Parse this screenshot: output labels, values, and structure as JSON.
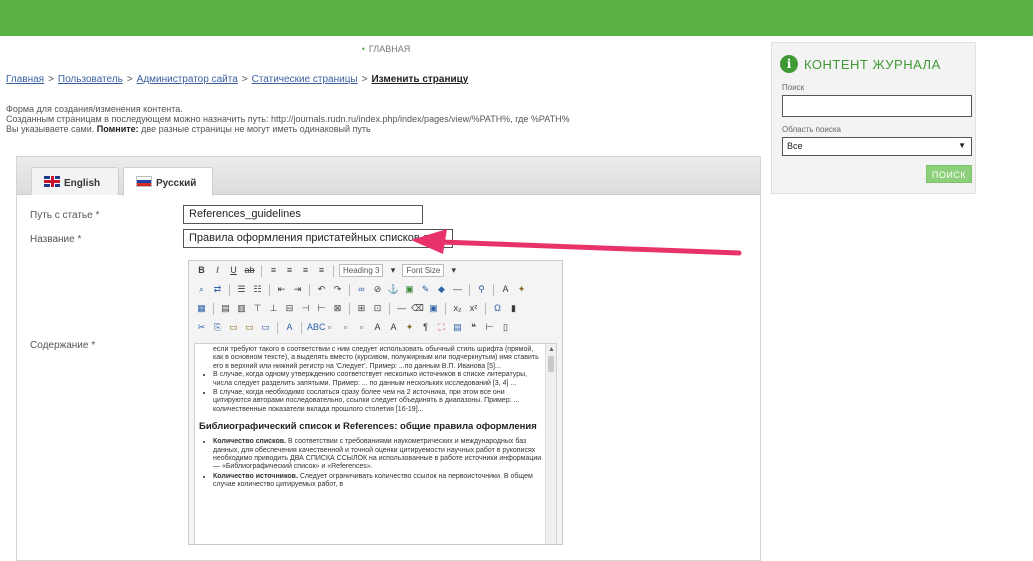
{
  "nav": {
    "home_label": "ГЛАВНАЯ"
  },
  "breadcrumb": {
    "items": [
      "Главная",
      "Пользователь",
      "Администратор сайта",
      "Статические страницы"
    ],
    "separator": ">",
    "current": "Изменить страницу"
  },
  "intro": {
    "line1": "Форма для создания/изменения контента.",
    "line2": "Созданным страницам в последующем можно назначить путь: http://journals.rudn.ru/index.php/index/pages/view/%PATH%, где %PATH%",
    "line3_prefix": "Вы указываете сами.",
    "line3_bold": "Помните:",
    "line3_suffix": "две разные страницы не могут иметь одинаковый путь"
  },
  "tabs": [
    {
      "label": "English",
      "flag": "uk-flag-icon"
    },
    {
      "label": "Русский",
      "flag": "ru-flag-icon"
    }
  ],
  "form": {
    "path_label": "Путь с статье *",
    "path_value": "References_guidelines",
    "title_label": "Название *",
    "title_value": "Правила оформления пристатейных списков л",
    "content_label": "Содержание *"
  },
  "editor": {
    "toolbar": {
      "bold": "B",
      "italic": "I",
      "underline": "U",
      "strike": "ab",
      "format_select": "Heading 3",
      "fontsize_select": "Font Size"
    },
    "content": {
      "para1": "если требуют такого в соответствии с ним следует использовать обычный стиль шрифта (прямой, как в основном тексте), а выделять вместо (курсивом, полужирным или подчеркнутым) имя ставить его в верхний или нижний регистр на 'Следует'. Пример: ...по данным В.П. Иванова [5]...",
      "bullet1": "В случае, когда одному утверждению соответствует несколько источников в списке литературы, числа следует разделить запятыми. Пример: ... по данным нескольких исследований [3, 4] ...",
      "bullet2": "В случае, когда необходимо сослаться сразу более чем на 2 источника, при этом все они цитируются авторами последовательно, ссылки следует объединять в диапазоны. Пример: ... количественные показатели вклада прошлого столетия [16-19]...",
      "heading": "Библиографический список и References: общие правила оформления",
      "bullet3_bold": "Количество списков.",
      "bullet3": "В соответствии с требованиями наукометрических и международных баз данных, для обеспечения качественной и точной оценки цитируемости научных работ в рукописях необходимо приводить ДВА СПИСКА ССЫЛОК на использованные в работе источники информации — «Библиографический список» и «References».",
      "bullet4_bold": "Количество источников.",
      "bullet4": "Следует ограничивать количество ссылок на первоисточники. В общем случае количество цитируемых работ, в"
    }
  },
  "sidebar": {
    "title": "КОНТЕНТ ЖУРНАЛА",
    "search_label": "Поиск",
    "scope_label": "Область поиска",
    "scope_value": "Все",
    "button_label": "ПОИСК"
  },
  "colors": {
    "brand_green": "#5cb144",
    "arrow": "#e8336a"
  }
}
